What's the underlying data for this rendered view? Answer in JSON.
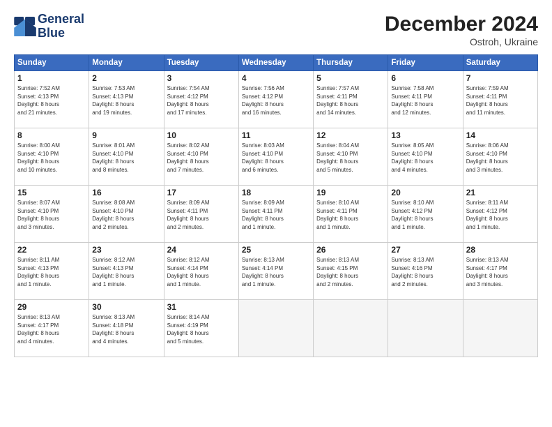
{
  "logo": {
    "line1": "General",
    "line2": "Blue"
  },
  "title": "December 2024",
  "subtitle": "Ostroh, Ukraine",
  "days_of_week": [
    "Sunday",
    "Monday",
    "Tuesday",
    "Wednesday",
    "Thursday",
    "Friday",
    "Saturday"
  ],
  "weeks": [
    [
      {
        "day": 1,
        "info": "Sunrise: 7:52 AM\nSunset: 4:13 PM\nDaylight: 8 hours\nand 21 minutes."
      },
      {
        "day": 2,
        "info": "Sunrise: 7:53 AM\nSunset: 4:13 PM\nDaylight: 8 hours\nand 19 minutes."
      },
      {
        "day": 3,
        "info": "Sunrise: 7:54 AM\nSunset: 4:12 PM\nDaylight: 8 hours\nand 17 minutes."
      },
      {
        "day": 4,
        "info": "Sunrise: 7:56 AM\nSunset: 4:12 PM\nDaylight: 8 hours\nand 16 minutes."
      },
      {
        "day": 5,
        "info": "Sunrise: 7:57 AM\nSunset: 4:11 PM\nDaylight: 8 hours\nand 14 minutes."
      },
      {
        "day": 6,
        "info": "Sunrise: 7:58 AM\nSunset: 4:11 PM\nDaylight: 8 hours\nand 12 minutes."
      },
      {
        "day": 7,
        "info": "Sunrise: 7:59 AM\nSunset: 4:11 PM\nDaylight: 8 hours\nand 11 minutes."
      }
    ],
    [
      {
        "day": 8,
        "info": "Sunrise: 8:00 AM\nSunset: 4:10 PM\nDaylight: 8 hours\nand 10 minutes."
      },
      {
        "day": 9,
        "info": "Sunrise: 8:01 AM\nSunset: 4:10 PM\nDaylight: 8 hours\nand 8 minutes."
      },
      {
        "day": 10,
        "info": "Sunrise: 8:02 AM\nSunset: 4:10 PM\nDaylight: 8 hours\nand 7 minutes."
      },
      {
        "day": 11,
        "info": "Sunrise: 8:03 AM\nSunset: 4:10 PM\nDaylight: 8 hours\nand 6 minutes."
      },
      {
        "day": 12,
        "info": "Sunrise: 8:04 AM\nSunset: 4:10 PM\nDaylight: 8 hours\nand 5 minutes."
      },
      {
        "day": 13,
        "info": "Sunrise: 8:05 AM\nSunset: 4:10 PM\nDaylight: 8 hours\nand 4 minutes."
      },
      {
        "day": 14,
        "info": "Sunrise: 8:06 AM\nSunset: 4:10 PM\nDaylight: 8 hours\nand 3 minutes."
      }
    ],
    [
      {
        "day": 15,
        "info": "Sunrise: 8:07 AM\nSunset: 4:10 PM\nDaylight: 8 hours\nand 3 minutes."
      },
      {
        "day": 16,
        "info": "Sunrise: 8:08 AM\nSunset: 4:10 PM\nDaylight: 8 hours\nand 2 minutes."
      },
      {
        "day": 17,
        "info": "Sunrise: 8:09 AM\nSunset: 4:11 PM\nDaylight: 8 hours\nand 2 minutes."
      },
      {
        "day": 18,
        "info": "Sunrise: 8:09 AM\nSunset: 4:11 PM\nDaylight: 8 hours\nand 1 minute."
      },
      {
        "day": 19,
        "info": "Sunrise: 8:10 AM\nSunset: 4:11 PM\nDaylight: 8 hours\nand 1 minute."
      },
      {
        "day": 20,
        "info": "Sunrise: 8:10 AM\nSunset: 4:12 PM\nDaylight: 8 hours\nand 1 minute."
      },
      {
        "day": 21,
        "info": "Sunrise: 8:11 AM\nSunset: 4:12 PM\nDaylight: 8 hours\nand 1 minute."
      }
    ],
    [
      {
        "day": 22,
        "info": "Sunrise: 8:11 AM\nSunset: 4:13 PM\nDaylight: 8 hours\nand 1 minute."
      },
      {
        "day": 23,
        "info": "Sunrise: 8:12 AM\nSunset: 4:13 PM\nDaylight: 8 hours\nand 1 minute."
      },
      {
        "day": 24,
        "info": "Sunrise: 8:12 AM\nSunset: 4:14 PM\nDaylight: 8 hours\nand 1 minute."
      },
      {
        "day": 25,
        "info": "Sunrise: 8:13 AM\nSunset: 4:14 PM\nDaylight: 8 hours\nand 1 minute."
      },
      {
        "day": 26,
        "info": "Sunrise: 8:13 AM\nSunset: 4:15 PM\nDaylight: 8 hours\nand 2 minutes."
      },
      {
        "day": 27,
        "info": "Sunrise: 8:13 AM\nSunset: 4:16 PM\nDaylight: 8 hours\nand 2 minutes."
      },
      {
        "day": 28,
        "info": "Sunrise: 8:13 AM\nSunset: 4:17 PM\nDaylight: 8 hours\nand 3 minutes."
      }
    ],
    [
      {
        "day": 29,
        "info": "Sunrise: 8:13 AM\nSunset: 4:17 PM\nDaylight: 8 hours\nand 4 minutes."
      },
      {
        "day": 30,
        "info": "Sunrise: 8:13 AM\nSunset: 4:18 PM\nDaylight: 8 hours\nand 4 minutes."
      },
      {
        "day": 31,
        "info": "Sunrise: 8:14 AM\nSunset: 4:19 PM\nDaylight: 8 hours\nand 5 minutes."
      },
      null,
      null,
      null,
      null
    ]
  ]
}
